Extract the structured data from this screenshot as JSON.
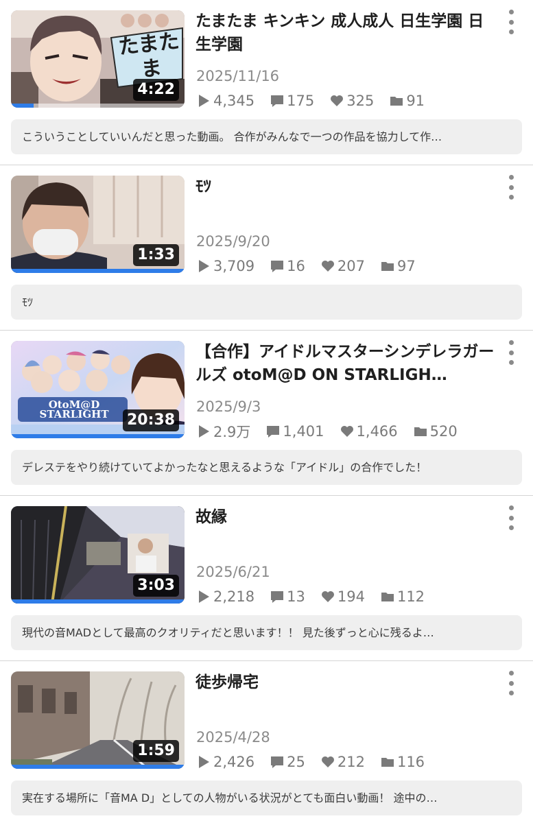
{
  "videos": [
    {
      "title": "たまたま キンキン 成人成人 日生学園 日生学園",
      "thumbnail_caption": "たまたま",
      "duration": "4:22",
      "progress": 0.13,
      "date": "2025/11/16",
      "views": "4,345",
      "comments": "175",
      "likes": "325",
      "mylists": "91",
      "description": "こういうことしていいんだと思った動画。 合作がみんなで一つの作品を協力して作…"
    },
    {
      "title": "ﾓﾂ",
      "duration": "1:33",
      "progress": 1.0,
      "date": "2025/9/20",
      "views": "3,709",
      "comments": "16",
      "likes": "207",
      "mylists": "97",
      "description": "ﾓﾂ"
    },
    {
      "title": "【合作】アイドルマスターシンデレラガールズ otoM@D ON STARLIGH…",
      "thumbnail_caption": "OtoM@D STARLIGHT",
      "duration": "20:38",
      "progress": 1.0,
      "date": "2025/9/3",
      "views": "2.9万",
      "comments": "1,401",
      "likes": "1,466",
      "mylists": "520",
      "description": "デレステをやり続けていてよかったなと思えるような「アイドル」の合作でした！"
    },
    {
      "title": "故縁",
      "duration": "3:03",
      "progress": 1.0,
      "date": "2025/6/21",
      "views": "2,218",
      "comments": "13",
      "likes": "194",
      "mylists": "112",
      "description": "現代の音MADとして最高のクオリティだと思います！！ 見た後ずっと心に残るよ…"
    },
    {
      "title": "徒歩帰宅",
      "duration": "1:59",
      "progress": 1.0,
      "date": "2025/4/28",
      "views": "2,426",
      "comments": "25",
      "likes": "212",
      "mylists": "116",
      "description": "実在する場所に「音MA D」としての人物がいる状況がとても面白い動画！ 途中の…"
    }
  ],
  "colors": {
    "progress": "#2e7ce8",
    "meta_text": "#8a8a8a",
    "desc_bg": "#efefef"
  }
}
